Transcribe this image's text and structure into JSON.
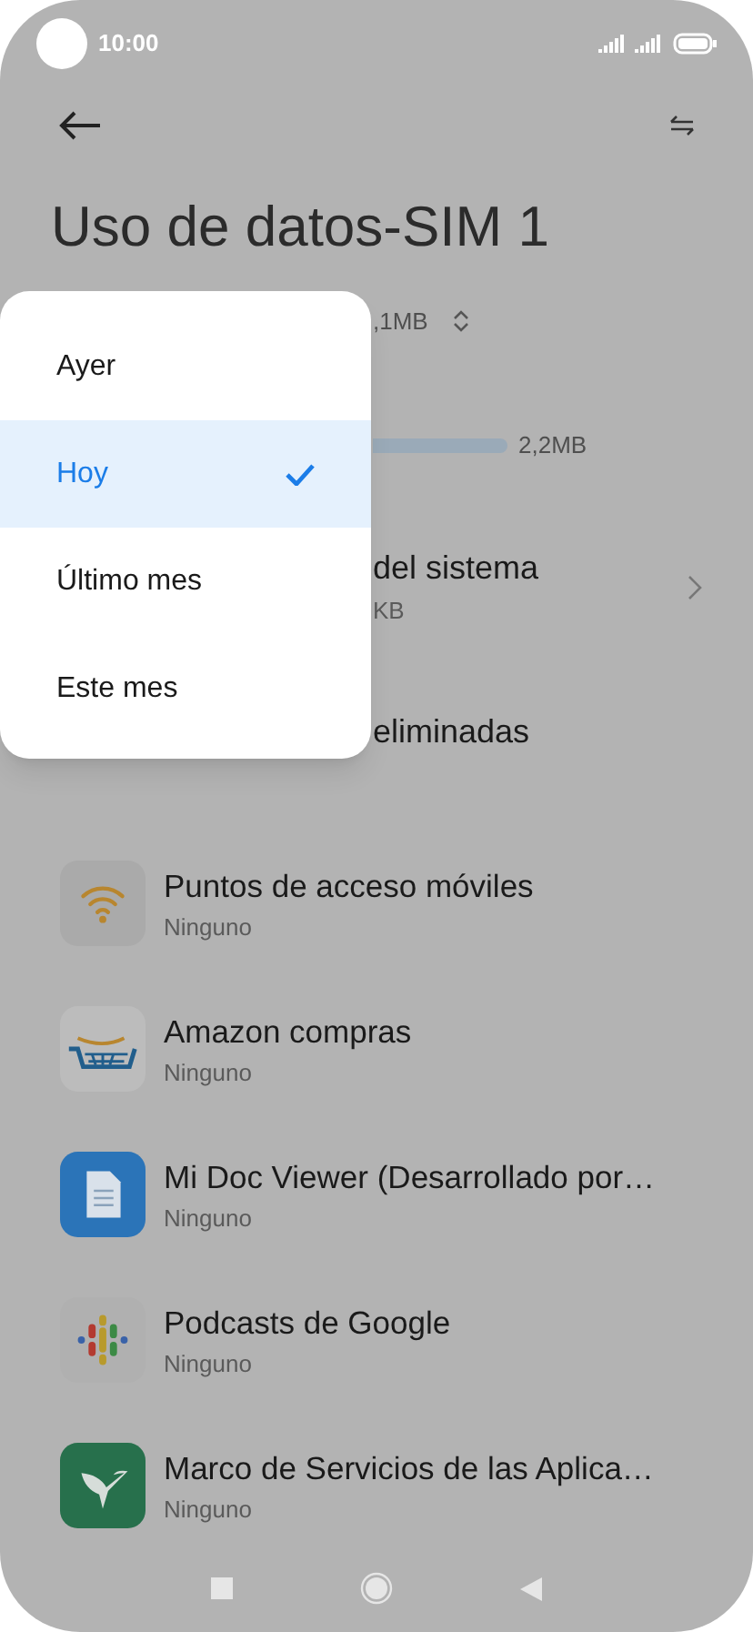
{
  "status_bar": {
    "time": "10:00"
  },
  "title": "Uso de datos-SIM 1",
  "total_usage": ",1MB",
  "usage_bar_label": "2,2MB",
  "partial_rows": [
    {
      "title": "del sistema",
      "subtitle": "KB",
      "kind": "link"
    },
    {
      "title": "eliminadas",
      "kind": "plain"
    }
  ],
  "apps": [
    {
      "name": "Puntos de acceso móviles",
      "usage": "Ninguno",
      "kind": "wifi"
    },
    {
      "name": "Amazon compras",
      "usage": "Ninguno",
      "kind": "cart"
    },
    {
      "name": "Mi Doc Viewer (Desarrollado por…",
      "usage": "Ninguno",
      "kind": "doc"
    },
    {
      "name": "Podcasts de Google",
      "usage": "Ninguno",
      "kind": "podcast"
    },
    {
      "name": "Marco de Servicios de las Aplica…",
      "usage": "Ninguno",
      "kind": "bird"
    }
  ],
  "period_menu": [
    {
      "label": "Ayer",
      "selected": false
    },
    {
      "label": "Hoy",
      "selected": true
    },
    {
      "label": "Último mes",
      "selected": false
    },
    {
      "label": "Este mes",
      "selected": false
    }
  ]
}
